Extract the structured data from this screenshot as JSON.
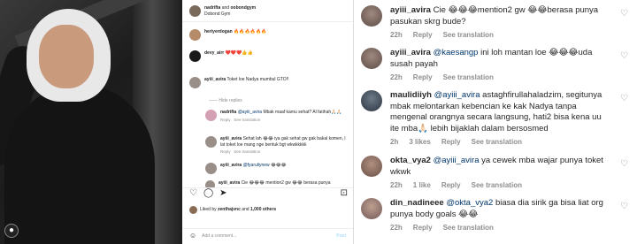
{
  "post": {
    "author": "nadrifta",
    "and": "and",
    "coauthor": "oobondgym",
    "location": "Dobond Gym",
    "profile_badge": "●",
    "comments": [
      {
        "user": "heriyerdogan",
        "text": "🔥🔥🔥🔥🔥🔥"
      },
      {
        "user": "devy_airr",
        "text": "❤️❤️❤️👍👍"
      },
      {
        "user": "ayiii_avira",
        "text": "Toket loe Nadya mumbul GTO!!"
      },
      {
        "hide_replies": "—— Hide replies"
      },
      {
        "user": "nadrifta",
        "mention": "@ayiii_avira",
        "text": "Mbak maaf kamu sehat? Al fatihah🙏🏻🙏🏻",
        "reply": "Reply",
        "translate": "See translation"
      },
      {
        "user": "ayiii_avira",
        "text": "Sehat lah 😂😂 iya gak sehat gw gak bakal komen, l lat toket loe mang nge bentuk bgt wkwkkkkk",
        "reply": "Reply",
        "translate": "See translation"
      },
      {
        "user": "ayiii_avira",
        "mention": "@fyaruliynew",
        "text": "😂😂😂"
      },
      {
        "user": "ayiii_avira",
        "text": "Cie 😂😂😂 mention2 gw 😂😂 berasa punya"
      }
    ],
    "actions": {
      "like": "♡",
      "comment": "◯",
      "share": "➤",
      "save": "⊡"
    },
    "likes": {
      "prefix": "Liked by",
      "user": "zenthajvnc",
      "suffix": "and",
      "others": "1,000 others"
    },
    "date": "",
    "add_comment": {
      "emoji": "☺",
      "placeholder": "Add a comment...",
      "post": "Post"
    }
  },
  "zoom": {
    "heart": "♡",
    "comments": [
      {
        "user": "ayiii_avira",
        "text": " Cie 😂😂😂mention2 gw 😂😂berasa punya pasukan skrg bude?",
        "time": "22h",
        "reply": "Reply",
        "translate": "See translation"
      },
      {
        "user": "ayiii_avira",
        "mention": "@kaesangp",
        "text": " ini loh mantan loe 😂😂😂uda susah payah",
        "time": "22h",
        "reply": "Reply",
        "translate": "See translation"
      },
      {
        "user": "maulidiiyh",
        "mention": "@ayiii_avira",
        "text": " astaghfirullahaladzim, segitunya mbak melontarkan kebencian ke kak Nadya tanpa mengenal orangnya secara langsung, hati2 bisa kena uu ite mba🙏🏻 lebih bijaklah dalam bersosmed",
        "time": "2h",
        "likes": "3 likes",
        "reply": "Reply",
        "translate": "See translation"
      },
      {
        "user": "okta_vya2",
        "mention": "@ayiii_avira",
        "text": " ya cewek mba wajar punya toket wkwk",
        "time": "22h",
        "likes": "1 like",
        "reply": "Reply",
        "translate": "See translation"
      },
      {
        "user": "din_nadineee",
        "mention": "@okta_vya2",
        "text": " biasa dia sirik ga bisa liat org punya body goals 😂😂",
        "time": "22h",
        "reply": "Reply",
        "translate": "See translation"
      }
    ]
  }
}
